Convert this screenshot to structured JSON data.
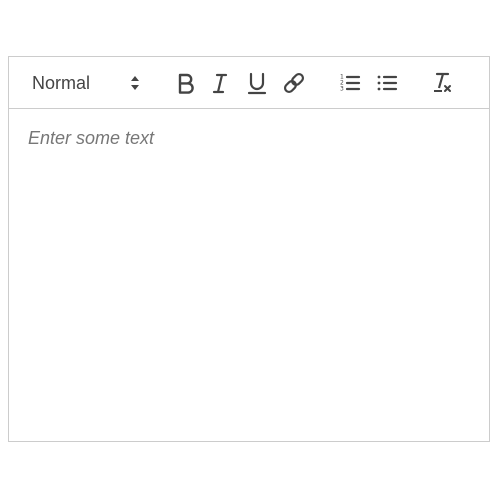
{
  "toolbar": {
    "header_select": {
      "value": "Normal",
      "icon": "up-down-arrows-icon"
    },
    "buttons": [
      {
        "name": "bold",
        "icon": "bold-icon"
      },
      {
        "name": "italic",
        "icon": "italic-icon"
      },
      {
        "name": "underline",
        "icon": "underline-icon"
      },
      {
        "name": "link",
        "icon": "link-icon"
      },
      {
        "name": "ordered-list",
        "icon": "ordered-list-icon"
      },
      {
        "name": "bullet-list",
        "icon": "bullet-list-icon"
      },
      {
        "name": "clear-format",
        "icon": "clear-format-icon"
      }
    ]
  },
  "editor": {
    "placeholder": "Enter some text",
    "value": ""
  },
  "colors": {
    "border": "#cccccc",
    "icon": "#444444",
    "placeholder": "#777777"
  }
}
